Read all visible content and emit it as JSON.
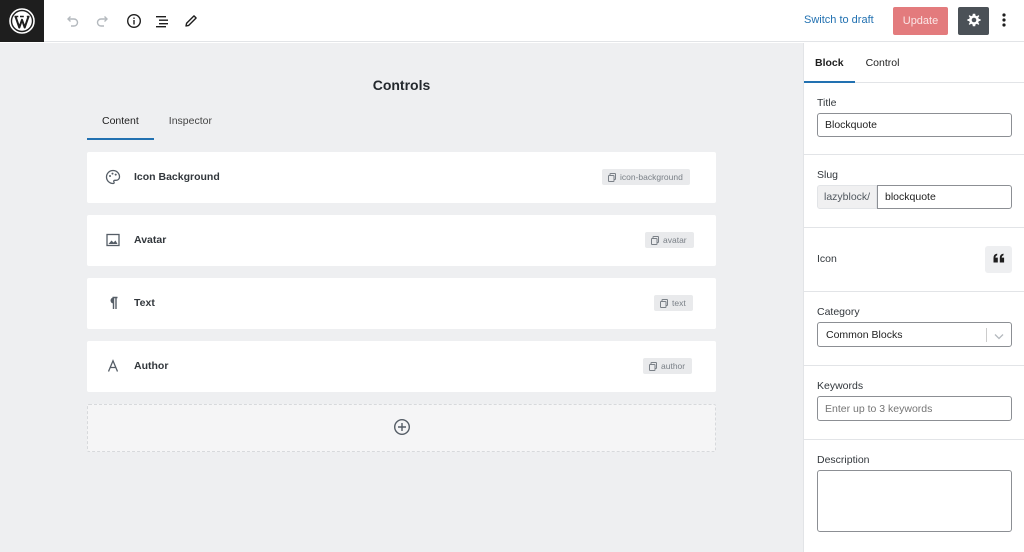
{
  "toolbar": {
    "switch_to_draft": "Switch to draft",
    "update_label": "Update",
    "icons": [
      "wordpress-logo",
      "undo-icon",
      "redo-icon",
      "info-icon",
      "outline-icon",
      "edit-icon",
      "settings-gear-icon",
      "more-vertical-icon"
    ]
  },
  "editor": {
    "title": "Controls",
    "tabs": [
      {
        "label": "Content",
        "active": true
      },
      {
        "label": "Inspector",
        "active": false
      }
    ],
    "controls": [
      {
        "label": "Icon Background",
        "slug": "icon-background",
        "icon": "palette-icon"
      },
      {
        "label": "Avatar",
        "slug": "avatar",
        "icon": "image-icon"
      },
      {
        "label": "Text",
        "slug": "text",
        "icon": "paragraph-icon"
      },
      {
        "label": "Author",
        "slug": "author",
        "icon": "letter-a-icon"
      }
    ],
    "add_icon": "plus-circle-icon"
  },
  "sidebar": {
    "tabs": [
      {
        "label": "Block",
        "active": true
      },
      {
        "label": "Control",
        "active": false
      }
    ],
    "title_label": "Title",
    "title_value": "Blockquote",
    "slug_label": "Slug",
    "slug_prefix": "lazyblock/",
    "slug_value": "blockquote",
    "icon_label": "Icon",
    "icon_value": "quote-icon",
    "category_label": "Category",
    "category_value": "Common Blocks",
    "keywords_label": "Keywords",
    "keywords_placeholder": "Enter up to 3 keywords",
    "description_label": "Description",
    "description_value": ""
  },
  "colors": {
    "accent": "#2271b1",
    "update_button": "#e37b7d",
    "settings_button": "#4b5157",
    "editor_background": "#eeeff1"
  }
}
